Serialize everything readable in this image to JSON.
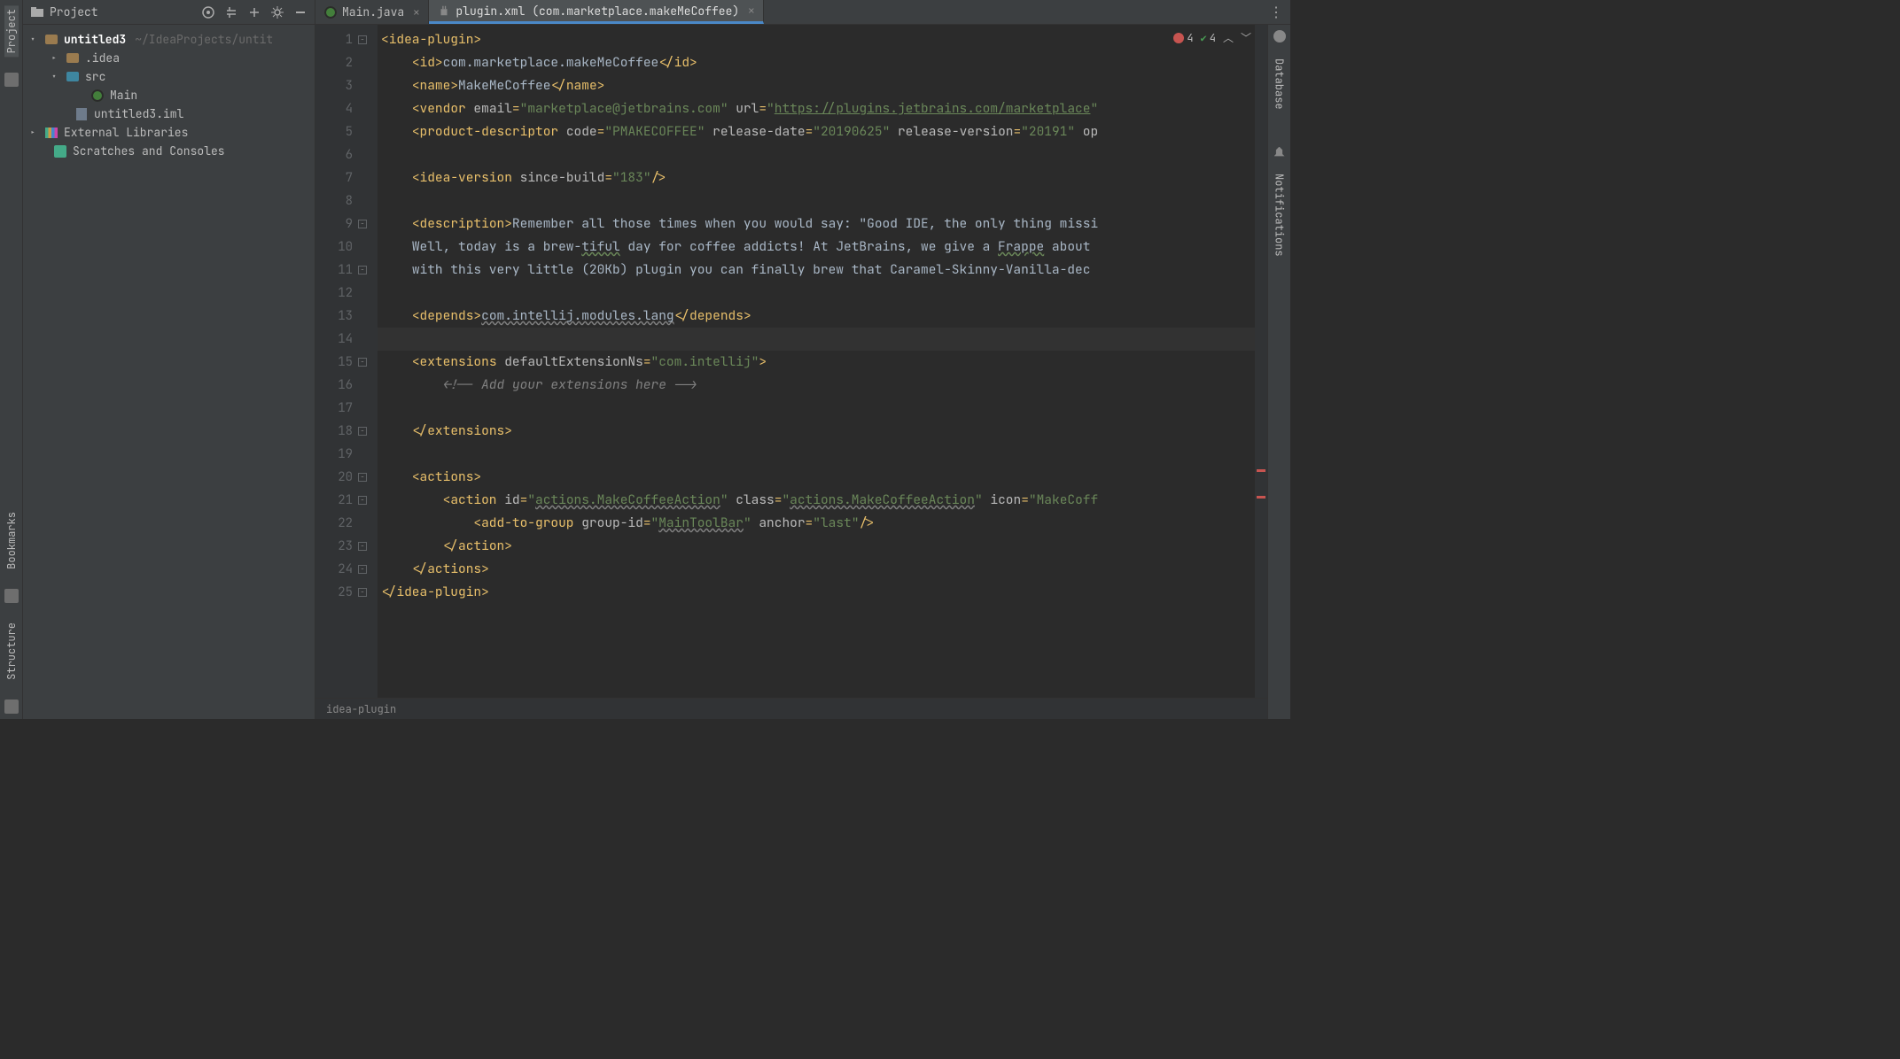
{
  "left_rail": {
    "top": [
      "Project"
    ],
    "bottom": [
      "Bookmarks",
      "Structure"
    ]
  },
  "right_rail": [
    "Database",
    "Notifications"
  ],
  "project_toolbar": {
    "title": "Project"
  },
  "tabs": [
    {
      "label": "Main.java",
      "active": false,
      "icon": "java"
    },
    {
      "label": "plugin.xml (com.marketplace.makeMeCoffee)",
      "active": true,
      "icon": "plugin"
    }
  ],
  "inspections": {
    "errors": 4,
    "warnings": 4
  },
  "project_tree": {
    "root": {
      "name": "untitled3",
      "hint": "~/IdeaProjects/untit"
    },
    "idea_folder": ".idea",
    "src_folder": "src",
    "main_file": "Main",
    "iml_file": "untitled3.iml",
    "external": "External Libraries",
    "scratches": "Scratches and Consoles"
  },
  "breadcrumb": "idea-plugin",
  "code_lines": [
    {
      "n": 1,
      "html": "<span class='xml-punc'>&lt;</span><span class='tagname'>idea-plugin</span><span class='xml-punc'>&gt;</span>"
    },
    {
      "n": 2,
      "html": "    <span class='xml-punc'>&lt;</span><span class='tagname'>id</span><span class='xml-punc'>&gt;</span><span class='t-txt'>com.marketplace.makeMeCoffee</span><span class='xml-punc'>&lt;/</span><span class='tagname'>id</span><span class='xml-punc'>&gt;</span>"
    },
    {
      "n": 3,
      "html": "    <span class='xml-punc'>&lt;</span><span class='tagname'>name</span><span class='xml-punc'>&gt;</span><span class='t-txt'>MakeMeCoffee</span><span class='xml-punc'>&lt;/</span><span class='tagname'>name</span><span class='xml-punc'>&gt;</span>"
    },
    {
      "n": 4,
      "html": "    <span class='xml-punc'>&lt;</span><span class='tagname'>vendor</span> <span class='t-attr'>email</span><span class='xml-punc'>=</span><span class='t-str'>\"marketplace@jetbrains.com\"</span> <span class='t-attr'>url</span><span class='xml-punc'>=</span><span class='t-str'>\"<span class='underline-link'>https://plugins.jetbrains.com/marketplace</span>\"</span>"
    },
    {
      "n": 5,
      "html": "    <span class='xml-punc'>&lt;</span><span class='tagname'>product-descriptor</span> <span class='t-attr'>code</span><span class='xml-punc'>=</span><span class='t-str'>\"PMAKECOFFEE\"</span> <span class='t-attr'>release-date</span><span class='xml-punc'>=</span><span class='t-str'>\"20190625\"</span> <span class='t-attr'>release-version</span><span class='xml-punc'>=</span><span class='t-str'>\"20191\"</span> <span class='t-attr'>op</span>"
    },
    {
      "n": 6,
      "html": ""
    },
    {
      "n": 7,
      "html": "    <span class='xml-punc'>&lt;</span><span class='tagname'>idea-version</span> <span class='t-attr'>since-build</span><span class='xml-punc'>=</span><span class='t-str'>\"183\"</span><span class='xml-punc'>/&gt;</span>"
    },
    {
      "n": 8,
      "html": ""
    },
    {
      "n": 9,
      "html": "    <span class='xml-punc'>&lt;</span><span class='tagname'>description</span><span class='xml-punc'>&gt;</span><span class='t-txt'>Remember all those times when you would say: \"Good IDE, the only thing missi</span>"
    },
    {
      "n": 10,
      "html": "    <span class='t-txt'>Well, today is a brew-<span class='underline-green'>tiful</span> day for coffee addicts! At JetBrains, we give a <span class='underline-green'>Frappe</span> about </span>"
    },
    {
      "n": 11,
      "html": "    <span class='t-txt'>with this very little (20Kb) plugin you can finally brew that Caramel-Skinny-Vanilla-de</span><span class='t-txt'>c</span>"
    },
    {
      "n": 12,
      "html": ""
    },
    {
      "n": 13,
      "html": "    <span class='xml-punc'>&lt;</span><span class='tagname'>depends</span><span class='xml-punc'>&gt;</span><span class='t-txt underline-wave'>com.intellij.modules.lang</span><span class='xml-punc'>&lt;/</span><span class='tagname'>depends</span><span class='xml-punc'>&gt;</span>"
    },
    {
      "n": 14,
      "html": "",
      "current": true
    },
    {
      "n": 15,
      "html": "    <span class='xml-punc'>&lt;</span><span class='tagname'>extensions</span> <span class='t-attr'>defaultExtensionNs</span><span class='xml-punc'>=</span><span class='t-str'>\"com.intellij\"</span><span class='xml-punc'>&gt;</span>"
    },
    {
      "n": 16,
      "html": "        <span class='t-cmt'>&lt;!-- Add your extensions here --&gt;</span>"
    },
    {
      "n": 17,
      "html": ""
    },
    {
      "n": 18,
      "html": "    <span class='xml-punc'>&lt;/</span><span class='tagname'>extensions</span><span class='xml-punc'>&gt;</span>"
    },
    {
      "n": 19,
      "html": ""
    },
    {
      "n": 20,
      "html": "    <span class='xml-punc'>&lt;</span><span class='tagname'>actions</span><span class='xml-punc'>&gt;</span>"
    },
    {
      "n": 21,
      "html": "        <span class='xml-punc'>&lt;</span><span class='tagname'>action</span> <span class='t-attr'>id</span><span class='xml-punc'>=</span><span class='t-str'>\"<span class='underline-wave'>actions.MakeCoffeeAction</span>\"</span> <span class='t-attr'>class</span><span class='xml-punc'>=</span><span class='t-str'>\"<span class='underline-wave'>actions.MakeCoffeeAction</span>\"</span> <span class='t-attr'>icon</span><span class='xml-punc'>=</span><span class='t-str'>\"MakeCoff</span>"
    },
    {
      "n": 22,
      "html": "            <span class='xml-punc'>&lt;</span><span class='tagname'>add-to-group</span> <span class='t-attr'>group-id</span><span class='xml-punc'>=</span><span class='t-str'>\"<span class='underline-wave'>MainToolBar</span>\"</span> <span class='t-attr'>anchor</span><span class='xml-punc'>=</span><span class='t-str'>\"last\"</span><span class='xml-punc'>/&gt;</span>"
    },
    {
      "n": 23,
      "html": "        <span class='xml-punc'>&lt;/</span><span class='tagname'>action</span><span class='xml-punc'>&gt;</span>"
    },
    {
      "n": 24,
      "html": "    <span class='xml-punc'>&lt;/</span><span class='tagname'>actions</span><span class='xml-punc'>&gt;</span>"
    },
    {
      "n": 25,
      "html": "<span class='xml-punc'>&lt;/</span><span class='tagname'>idea-plugin</span><span class='xml-punc'>&gt;</span>"
    }
  ],
  "fold_marks": [
    1,
    9,
    11,
    15,
    18,
    20,
    21,
    23,
    24,
    25
  ],
  "error_marks_pct": [
    66,
    70
  ]
}
